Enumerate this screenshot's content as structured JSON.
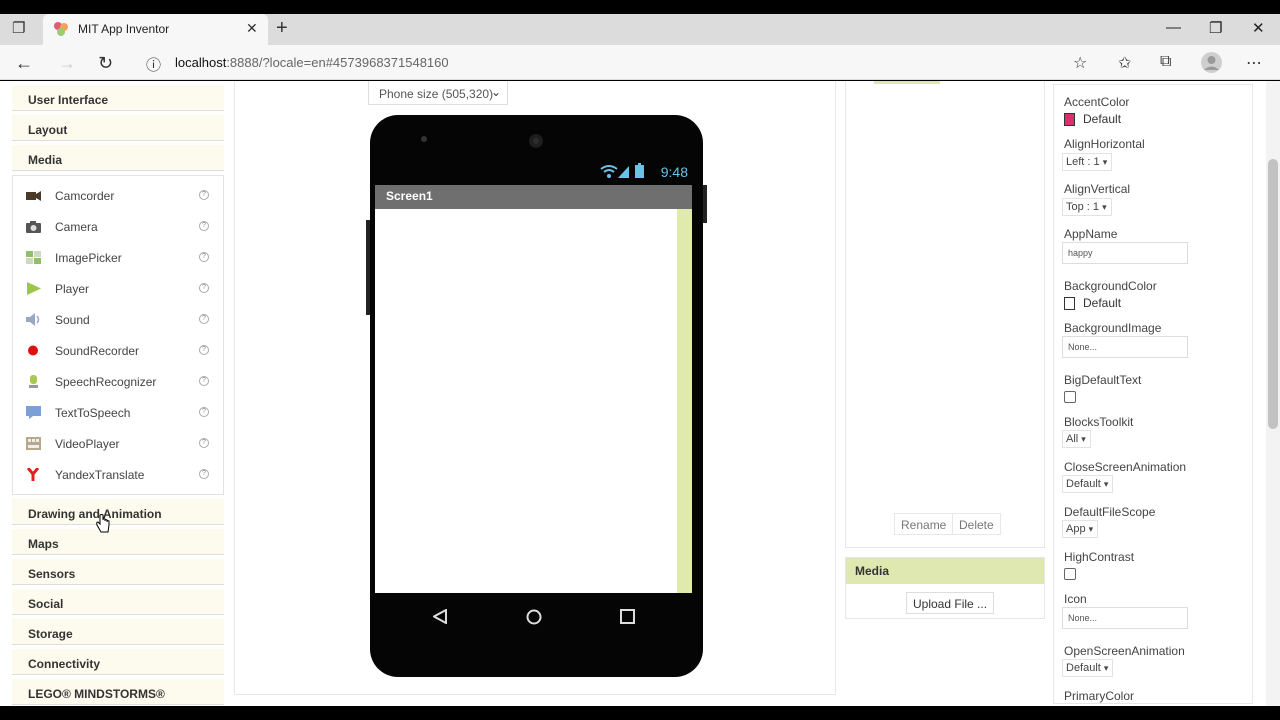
{
  "browser": {
    "tab_title": "MIT App Inventor",
    "tab_close": "✕",
    "new_tab": "+",
    "url_host": "localhost",
    "url_rest": ":8888/?locale=en#4573968371548160",
    "win_min": "—",
    "win_max": "❐",
    "win_close": "✕"
  },
  "palette": {
    "categories_top": [
      "User Interface",
      "Layout",
      "Media"
    ],
    "media_items": [
      {
        "label": "Camcorder",
        "icon": "camcorder-icon"
      },
      {
        "label": "Camera",
        "icon": "camera-icon"
      },
      {
        "label": "ImagePicker",
        "icon": "imagepicker-icon"
      },
      {
        "label": "Player",
        "icon": "player-icon"
      },
      {
        "label": "Sound",
        "icon": "sound-icon"
      },
      {
        "label": "SoundRecorder",
        "icon": "soundrecorder-icon"
      },
      {
        "label": "SpeechRecognizer",
        "icon": "speechrecognizer-icon"
      },
      {
        "label": "TextToSpeech",
        "icon": "texttospeech-icon"
      },
      {
        "label": "VideoPlayer",
        "icon": "videoplayer-icon"
      },
      {
        "label": "YandexTranslate",
        "icon": "yandextranslate-icon"
      }
    ],
    "categories_bottom": [
      "Drawing and Animation",
      "Maps",
      "Sensors",
      "Social",
      "Storage",
      "Connectivity",
      "LEGO® MINDSTORMS®"
    ],
    "help_glyph": "?"
  },
  "viewer": {
    "size_select": "Phone size (505,320)",
    "clock": "9:48",
    "screen_title": "Screen1"
  },
  "components": {
    "rename": "Rename",
    "delete": "Delete"
  },
  "media_panel": {
    "title": "Media",
    "upload": "Upload File ..."
  },
  "properties": {
    "accent_label": "AccentColor",
    "accent_value": "Default",
    "accent_color": "#d6336c",
    "alignh_label": "AlignHorizontal",
    "alignh_value": "Left : 1",
    "alignv_label": "AlignVertical",
    "alignv_value": "Top : 1",
    "appname_label": "AppName",
    "appname_value": "happy",
    "bgcolor_label": "BackgroundColor",
    "bgcolor_value": "Default",
    "bgcolor_color": "#ffffff",
    "bgimage_label": "BackgroundImage",
    "bgimage_value": "None...",
    "bigtext_label": "BigDefaultText",
    "blocks_label": "BlocksToolkit",
    "blocks_value": "All",
    "closeanim_label": "CloseScreenAnimation",
    "closeanim_value": "Default",
    "filescope_label": "DefaultFileScope",
    "filescope_value": "App",
    "contrast_label": "HighContrast",
    "icon_label": "Icon",
    "icon_value": "None...",
    "openanim_label": "OpenScreenAnimation",
    "openanim_value": "Default",
    "primary_label": "PrimaryColor",
    "dd_arrow": "▾"
  }
}
